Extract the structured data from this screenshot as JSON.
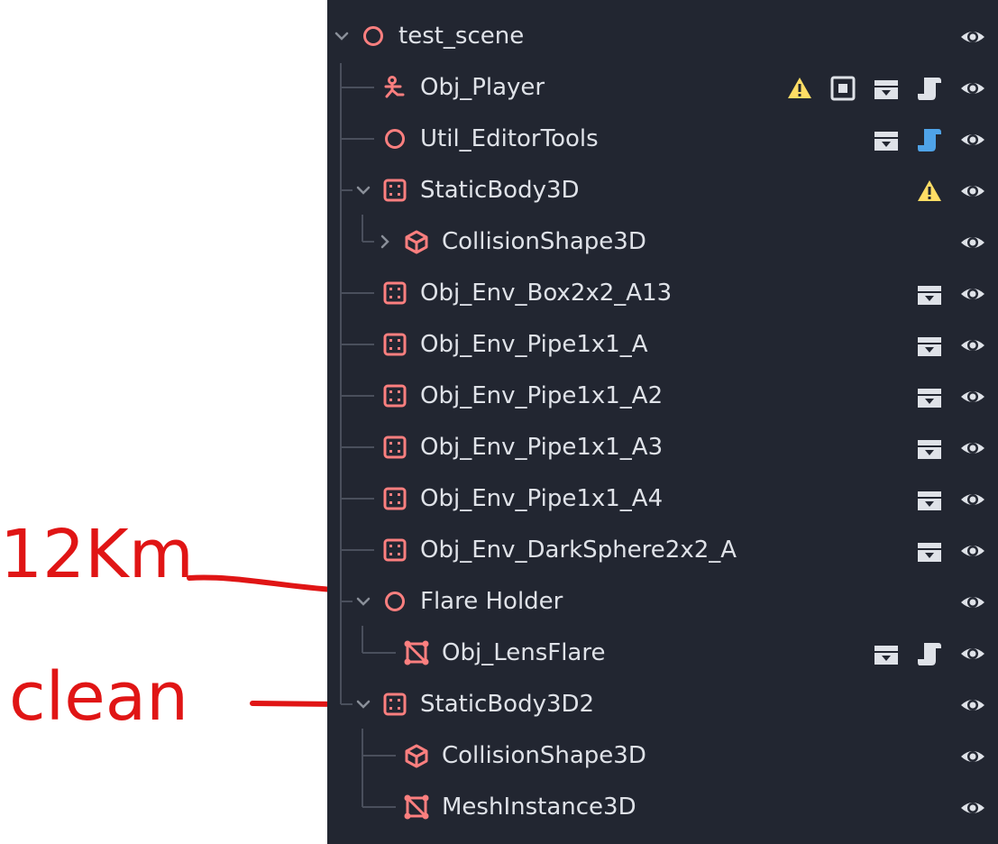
{
  "annotations": {
    "note_1": "12Km",
    "note_2": "clean"
  },
  "colors": {
    "panel_bg": "#222631",
    "node_red": "#fc7f7f",
    "text": "#dfe2e8",
    "warning": "#ffdd65",
    "script_blue": "#4fa3e8",
    "ink_red": "#e01515"
  },
  "scene_tree": {
    "nodes": [
      {
        "label": "test_scene",
        "icon": "node3d-circle-icon",
        "badges": []
      },
      {
        "label": "Obj_Player",
        "icon": "character-body-icon",
        "badges": [
          "warning-icon",
          "instance-icon",
          "scene-clapper-icon",
          "script-icon"
        ]
      },
      {
        "label": "Util_EditorTools",
        "icon": "node3d-circle-icon",
        "badges": [
          "scene-clapper-icon",
          "script-blue-icon"
        ]
      },
      {
        "label": "StaticBody3D",
        "icon": "static-body-icon",
        "badges": [
          "warning-icon"
        ]
      },
      {
        "label": "CollisionShape3D",
        "icon": "collision-shape-icon",
        "badges": []
      },
      {
        "label": "Obj_Env_Box2x2_A13",
        "icon": "static-body-icon",
        "badges": [
          "scene-clapper-icon"
        ]
      },
      {
        "label": "Obj_Env_Pipe1x1_A",
        "icon": "static-body-icon",
        "badges": [
          "scene-clapper-icon"
        ]
      },
      {
        "label": "Obj_Env_Pipe1x1_A2",
        "icon": "static-body-icon",
        "badges": [
          "scene-clapper-icon"
        ]
      },
      {
        "label": "Obj_Env_Pipe1x1_A3",
        "icon": "static-body-icon",
        "badges": [
          "scene-clapper-icon"
        ]
      },
      {
        "label": "Obj_Env_Pipe1x1_A4",
        "icon": "static-body-icon",
        "badges": [
          "scene-clapper-icon"
        ]
      },
      {
        "label": "Obj_Env_DarkSphere2x2_A",
        "icon": "static-body-icon",
        "badges": [
          "scene-clapper-icon"
        ]
      },
      {
        "label": "Flare Holder",
        "icon": "node3d-circle-icon",
        "badges": []
      },
      {
        "label": "Obj_LensFlare",
        "icon": "mesh-instance-icon",
        "badges": [
          "scene-clapper-icon",
          "script-icon"
        ]
      },
      {
        "label": "StaticBody3D2",
        "icon": "static-body-icon",
        "badges": []
      },
      {
        "label": "CollisionShape3D",
        "icon": "collision-shape-icon",
        "badges": []
      },
      {
        "label": "MeshInstance3D",
        "icon": "mesh-instance-icon",
        "badges": []
      }
    ]
  }
}
